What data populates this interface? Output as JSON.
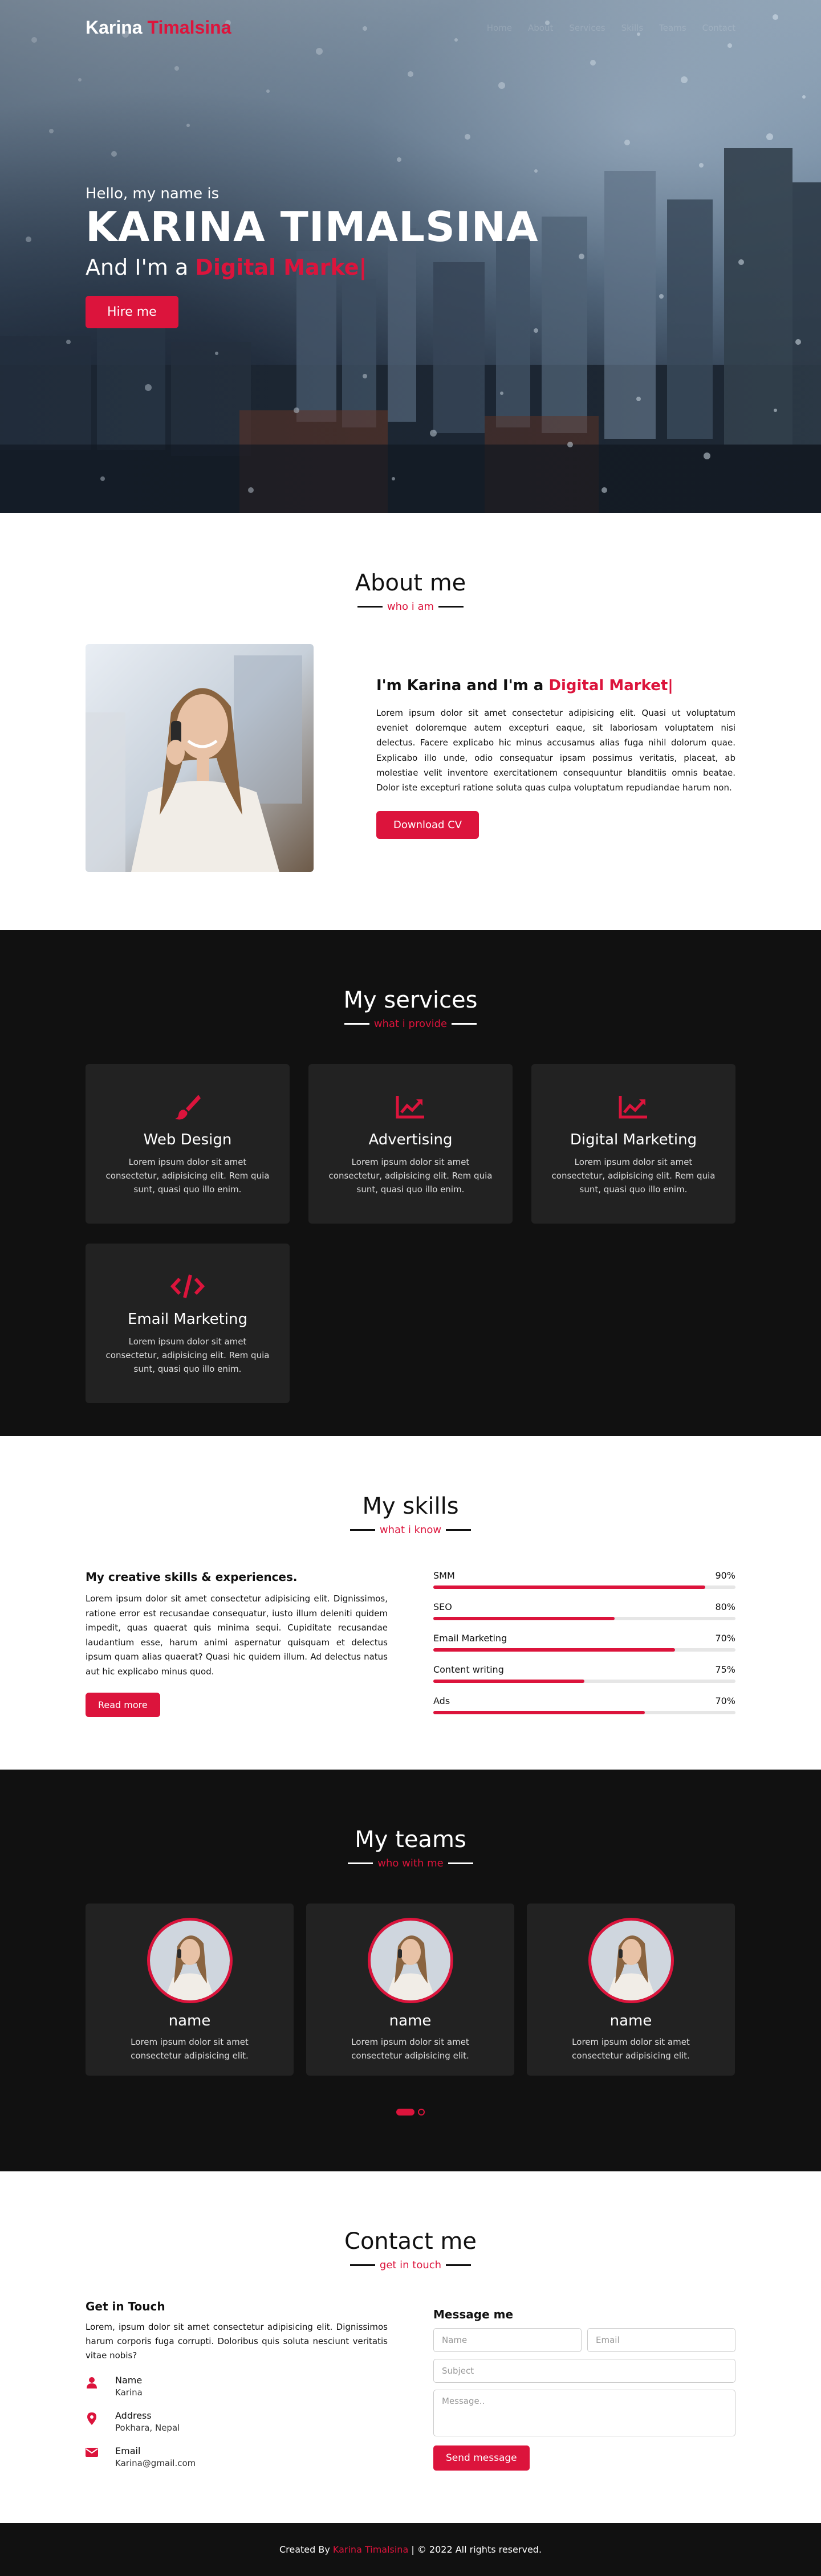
{
  "brand": {
    "first": "Karina",
    "last": "Timalsina",
    "accent_color": "#dc143c"
  },
  "nav": [
    "Home",
    "About",
    "Services",
    "Skills",
    "Teams",
    "Contact"
  ],
  "hero": {
    "greeting": "Hello, my name is",
    "name": "KARINA TIMALSINA",
    "role_prefix": "And I'm a ",
    "role_typed": "Digital Marke|",
    "hire_label": "Hire me"
  },
  "about": {
    "title": "About me",
    "subtitle": "who i am",
    "heading_prefix": "I'm Karina and I'm a ",
    "heading_typed": "Digital Market|",
    "paragraph": "Lorem ipsum dolor sit amet consectetur adipisicing elit. Quasi ut voluptatum eveniet doloremque autem excepturi eaque, sit laboriosam voluptatem nisi delectus. Facere explicabo hic minus accusamus alias fuga nihil dolorum quae. Explicabo illo unde, odio consequatur ipsam possimus veritatis, placeat, ab molestiae velit inventore exercitationem consequuntur blanditiis omnis beatae. Dolor iste excepturi ratione soluta quas culpa voluptatum repudiandae harum non.",
    "button": "Download CV"
  },
  "services": {
    "title": "My services",
    "subtitle": "what i provide",
    "items": [
      {
        "icon": "paint-brush-icon",
        "title": "Web Design",
        "text": "Lorem ipsum dolor sit amet consectetur, adipisicing elit. Rem quia sunt, quasi quo illo enim."
      },
      {
        "icon": "chart-line-icon",
        "title": "Advertising",
        "text": "Lorem ipsum dolor sit amet consectetur, adipisicing elit. Rem quia sunt, quasi quo illo enim."
      },
      {
        "icon": "chart-line-icon",
        "title": "Digital Marketing",
        "text": "Lorem ipsum dolor sit amet consectetur, adipisicing elit. Rem quia sunt, quasi quo illo enim."
      },
      {
        "icon": "code-icon",
        "title": "Email Marketing",
        "text": "Lorem ipsum dolor sit amet consectetur, adipisicing elit. Rem quia sunt, quasi quo illo enim."
      }
    ]
  },
  "skills": {
    "title": "My skills",
    "subtitle": "what i know",
    "heading": "My creative skills & experiences.",
    "paragraph": "Lorem ipsum dolor sit amet consectetur adipisicing elit. Dignissimos, ratione error est recusandae consequatur, iusto illum deleniti quidem impedit, quas quaerat quis minima sequi. Cupiditate recusandae laudantium esse, harum animi aspernatur quisquam et delectus ipsum quam alias quaerat? Quasi hic quidem illum. Ad delectus natus aut hic explicabo minus quod.",
    "button": "Read more",
    "bars": [
      {
        "label": "SMM",
        "percent_text": "90%",
        "value": 0.9
      },
      {
        "label": "SEO",
        "percent_text": "80%",
        "value": 0.6
      },
      {
        "label": "Email Marketing",
        "percent_text": "70%",
        "value": 0.8
      },
      {
        "label": "Content writing",
        "percent_text": "75%",
        "value": 0.5
      },
      {
        "label": "Ads",
        "percent_text": "70%",
        "value": 0.7
      }
    ]
  },
  "teams": {
    "title": "My teams",
    "subtitle": "who with me",
    "members": [
      {
        "name": "name",
        "text": "Lorem ipsum dolor sit amet consectetur adipisicing elit."
      },
      {
        "name": "name",
        "text": "Lorem ipsum dolor sit amet consectetur adipisicing elit."
      },
      {
        "name": "name",
        "text": "Lorem ipsum dolor sit amet consectetur adipisicing elit."
      }
    ]
  },
  "contact": {
    "title": "Contact me",
    "subtitle": "get in touch",
    "get_in_touch": "Get in Touch",
    "paragraph": "Lorem, ipsum dolor sit amet consectetur adipisicing elit. Dignissimos harum corporis fuga corrupti. Doloribus quis soluta nesciunt veritatis vitae nobis?",
    "info": [
      {
        "icon": "user-icon",
        "head": "Name",
        "value": "Karina"
      },
      {
        "icon": "map-marker-icon",
        "head": "Address",
        "value": "Pokhara, Nepal"
      },
      {
        "icon": "envelope-icon",
        "head": "Email",
        "value": "Karina@gmail.com"
      }
    ],
    "form_title": "Message me",
    "placeholders": {
      "name": "Name",
      "email": "Email",
      "subject": "Subject",
      "message": "Message.."
    },
    "send": "Send message"
  },
  "footer": {
    "prefix": "Created By ",
    "author": "Karina Timalsina",
    "suffix": " | © 2022 All rights reserved."
  }
}
